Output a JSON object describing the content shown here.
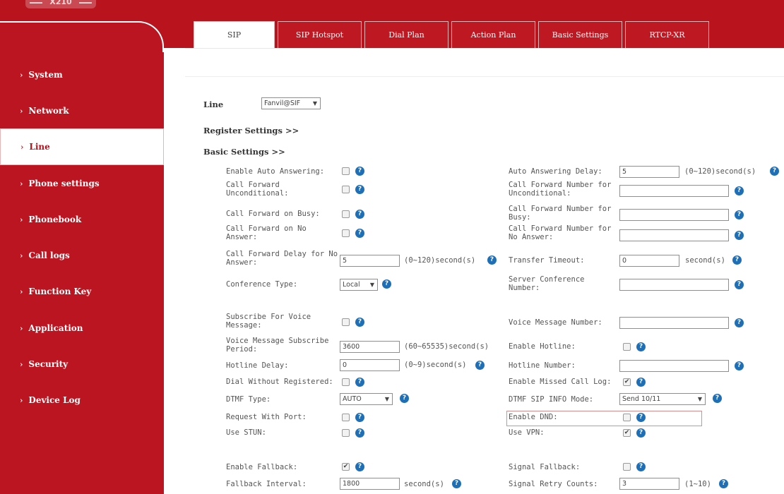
{
  "header": {
    "logo_text": "X210"
  },
  "tabs": [
    {
      "label": "SIP",
      "active": true
    },
    {
      "label": "SIP Hotspot",
      "active": false
    },
    {
      "label": "Dial Plan",
      "active": false
    },
    {
      "label": "Action Plan",
      "active": false
    },
    {
      "label": "Basic Settings",
      "active": false
    },
    {
      "label": "RTCP-XR",
      "active": false
    }
  ],
  "sidebar": {
    "items": [
      {
        "label": "System"
      },
      {
        "label": "Network"
      },
      {
        "label": "Line",
        "active": true
      },
      {
        "label": "Phone settings"
      },
      {
        "label": "Phonebook"
      },
      {
        "label": "Call logs"
      },
      {
        "label": "Function Key"
      },
      {
        "label": "Application"
      },
      {
        "label": "Security"
      },
      {
        "label": "Device Log"
      }
    ]
  },
  "line": {
    "label": "Line",
    "value": "Fanvil@SIF"
  },
  "sections": {
    "register": "Register Settings >>",
    "basic": "Basic Settings >>"
  },
  "form": {
    "auto_answer_label": "Enable Auto Answering:",
    "auto_answer_delay_label": "Auto Answering Delay:",
    "auto_answer_delay_value": "5",
    "auto_answer_delay_unit": "(0~120)second(s)",
    "cf_uncond_label_1": "Call Forward",
    "cf_uncond_label_2": "Unconditional:",
    "cf_uncond_num_label_1": "Call Forward Number for",
    "cf_uncond_num_label_2": "Unconditional:",
    "cf_busy_label": "Call Forward on Busy:",
    "cf_busy_num_label_1": "Call Forward Number for",
    "cf_busy_num_label_2": "Busy:",
    "cf_noans_label_1": "Call Forward on No",
    "cf_noans_label_2": "Answer:",
    "cf_noans_num_label_1": "Call Forward Number for",
    "cf_noans_num_label_2": "No Answer:",
    "cf_delay_label_1": "Call Forward Delay for No",
    "cf_delay_label_2": "Answer:",
    "cf_delay_value": "5",
    "cf_delay_unit": "(0~120)second(s)",
    "transfer_timeout_label": "Transfer Timeout:",
    "transfer_timeout_value": "0",
    "transfer_timeout_unit": "second(s)",
    "conference_type_label": "Conference Type:",
    "conference_type_value": "Local",
    "server_conf_label_1": "Server Conference",
    "server_conf_label_2": "Number:",
    "subscribe_vm_label_1": "Subscribe For Voice",
    "subscribe_vm_label_2": "Message:",
    "vm_number_label": "Voice Message Number:",
    "vm_period_label_1": "Voice Message Subscribe",
    "vm_period_label_2": "Period:",
    "vm_period_value": "3600",
    "vm_period_unit": "(60~65535)second(s)",
    "enable_hotline_label": "Enable Hotline:",
    "hotline_delay_label": "Hotline Delay:",
    "hotline_delay_value": "0",
    "hotline_delay_unit": "(0~9)second(s)",
    "hotline_number_label": "Hotline Number:",
    "dial_without_reg_label": "Dial Without Registered:",
    "missed_call_log_label": "Enable Missed Call Log:",
    "dtmf_type_label": "DTMF Type:",
    "dtmf_type_value": "AUTO",
    "dtmf_sip_info_label": "DTMF SIP INFO Mode:",
    "dtmf_sip_info_value": "Send 10/11",
    "request_with_port_label": "Request With Port:",
    "enable_dnd_label": "Enable DND:",
    "use_stun_label": "Use STUN:",
    "use_vpn_label": "Use VPN:",
    "enable_fallback_label": "Enable Fallback:",
    "signal_fallback_label": "Signal Fallback:",
    "fallback_interval_label": "Fallback Interval:",
    "fallback_interval_value": "1800",
    "fallback_interval_unit": "second(s)",
    "signal_retry_label": "Signal Retry Counts:",
    "signal_retry_value": "3",
    "signal_retry_unit": "(1~10)"
  },
  "checkboxes": {
    "auto_answer": false,
    "cf_uncond": false,
    "cf_busy": false,
    "cf_noans": false,
    "subscribe_vm": false,
    "enable_hotline": false,
    "dial_without_reg": false,
    "missed_call_log": true,
    "request_with_port": false,
    "enable_dnd": false,
    "use_stun": false,
    "use_vpn": true,
    "enable_fallback": true,
    "signal_fallback": false
  },
  "icons": {
    "help": "help-circle-icon",
    "checkmark": "checkmark-icon",
    "select_arrow": "dropdown-arrow-icon",
    "nav_chevron": "chevron-right-icon"
  },
  "help_glyph": "?",
  "check_glyph": "✔",
  "arrow_glyph": "▼",
  "chevron_glyph": "›",
  "colors": {
    "brand_red": "#b9141e",
    "help_blue": "#1f6fb6",
    "highlight_border": "#d98e8e"
  }
}
